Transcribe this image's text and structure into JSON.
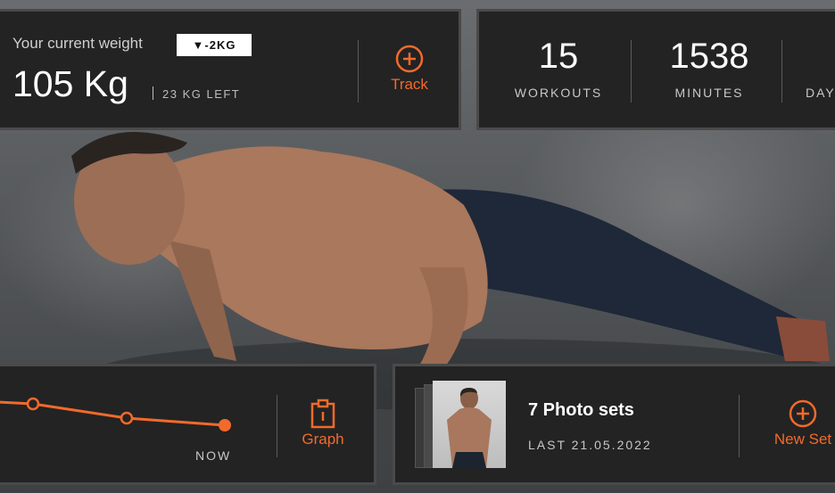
{
  "weight": {
    "label": "Your current weight",
    "change_badge": "▼-2KG",
    "value": "105 Kg",
    "left_text": "23 KG LEFT",
    "track_label": "Track"
  },
  "stats": [
    {
      "value": "15",
      "label": "WORKOUTS"
    },
    {
      "value": "1538",
      "label": "MINUTES"
    },
    {
      "value": "",
      "label": "DAY"
    }
  ],
  "graph": {
    "now_label": "NOW",
    "button_label": "Graph"
  },
  "photos": {
    "title": "7 Photo sets",
    "subtitle": "LAST 21.05.2022",
    "button_label": "New Set"
  },
  "colors": {
    "accent": "#f26a2b",
    "card_bg": "#232323",
    "card_border": "#4a4a4a"
  },
  "icons": {
    "track": "plus-circle-icon",
    "graph": "clipboard-icon",
    "new_set": "plus-circle-icon"
  }
}
